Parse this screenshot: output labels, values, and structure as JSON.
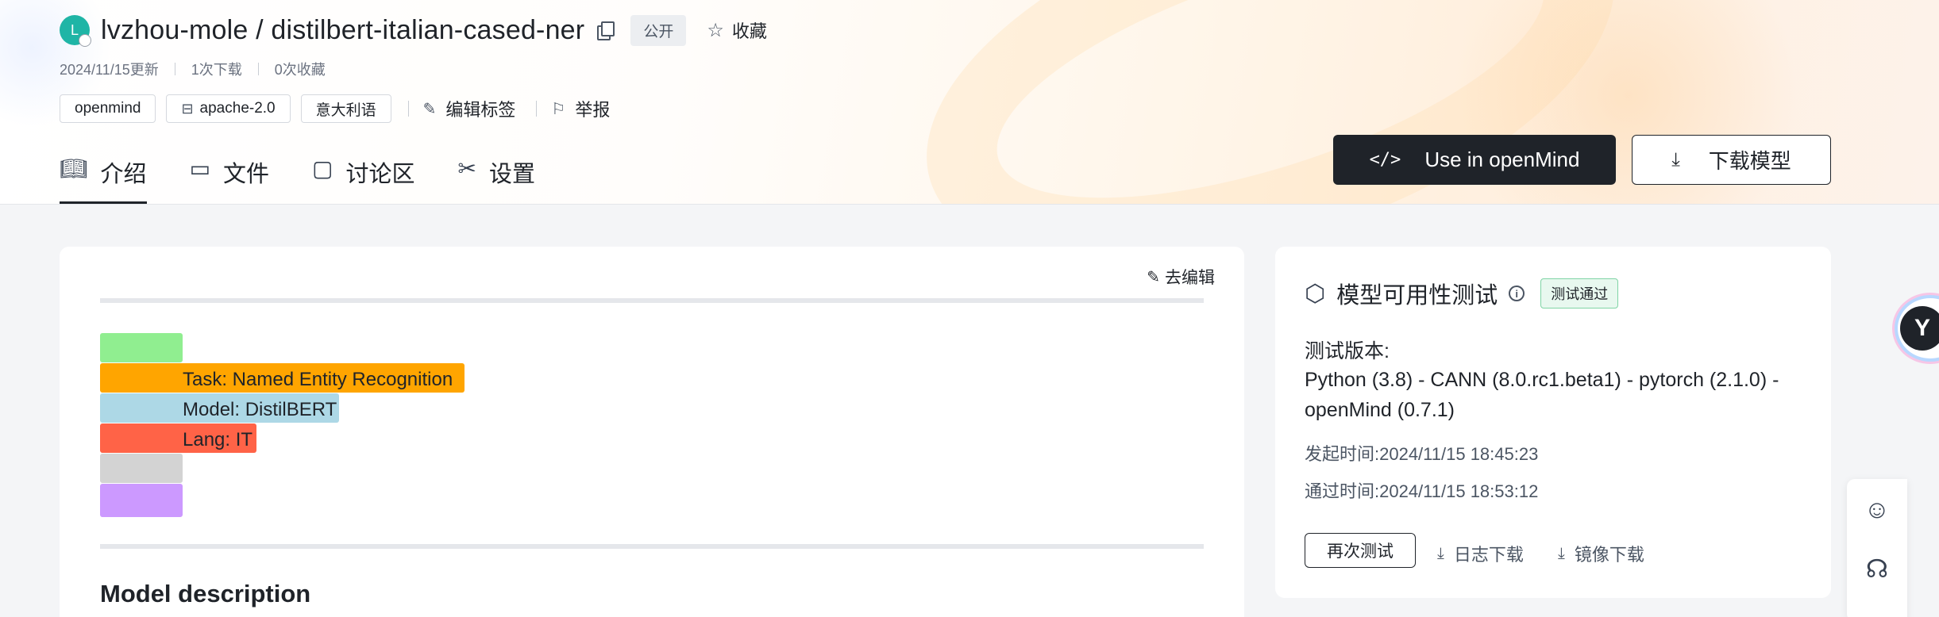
{
  "header": {
    "avatar_letter": "L",
    "repo_title": "lvzhou-mole / distilbert-italian-cased-ner",
    "public_label": "公开",
    "favorite_label": "收藏",
    "meta": {
      "updated": "2024/11/15更新",
      "downloads": "1次下载",
      "favorites": "0次收藏"
    },
    "tags": [
      {
        "label": "openmind",
        "icon": ""
      },
      {
        "label": "apache-2.0",
        "icon": "license-icon"
      },
      {
        "label": "意大利语",
        "icon": ""
      }
    ],
    "edit_tags_label": "编辑标签",
    "report_label": "举报",
    "tabs": [
      {
        "label": "介绍",
        "icon": "book-icon",
        "active": true
      },
      {
        "label": "文件",
        "icon": "terminal-folder-icon",
        "active": false
      },
      {
        "label": "讨论区",
        "icon": "chat-icon",
        "active": false
      },
      {
        "label": "设置",
        "icon": "tools-icon",
        "active": false
      }
    ],
    "use_button_label": "Use in openMind",
    "download_button_label": "下载模型"
  },
  "main": {
    "edit_label": "去编辑",
    "color_bars": [
      {
        "label": "",
        "color": "#90ee90"
      },
      {
        "label": "Task: Named Entity Recognition",
        "color": "#ffa500"
      },
      {
        "label": "Model: DistilBERT",
        "color": "#add8e6"
      },
      {
        "label": "Lang: IT",
        "color": "#ff6347"
      },
      {
        "label": "",
        "color": "#d3d3d3"
      },
      {
        "label": "",
        "color": "#cc99ff"
      }
    ],
    "section_heading": "Model description"
  },
  "side": {
    "title": "模型可用性测试",
    "pass_badge": "测试通过",
    "version_label": "测试版本:",
    "version_text": "Python (3.8) - CANN (8.0.rc1.beta1) - pytorch (2.1.0) - openMind (0.7.1)",
    "start_time": "发起时间:2024/11/15 18:45:23",
    "pass_time": "通过时间:2024/11/15 18:53:12",
    "retest_label": "再次测试",
    "log_download_label": "日志下载",
    "image_download_label": "镜像下载"
  },
  "colors": {
    "dark_button": "#1f2329",
    "pass_green": "#e8f8ef",
    "avatar_teal": "#1fb5a6"
  }
}
